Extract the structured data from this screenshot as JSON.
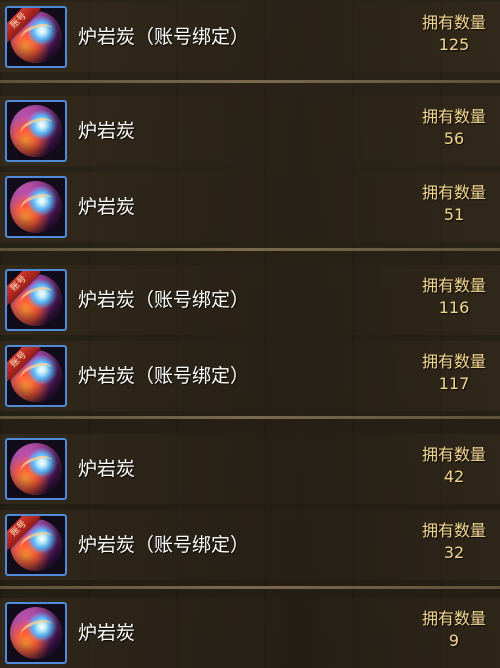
{
  "count_label": "拥有数量",
  "bound_tag": "账号",
  "colors": {
    "name_text": "#ffffff",
    "count_text": "#f3d690",
    "icon_border": "#4f8bd8",
    "bound_ribbon": "#d23b2f"
  },
  "icon": "lava-coal-orb-icon",
  "items": [
    {
      "name": "炉岩炭（账号绑定）",
      "bound": true,
      "count": "125"
    },
    {
      "name": "炉岩炭",
      "bound": false,
      "count": "56"
    },
    {
      "name": "炉岩炭",
      "bound": false,
      "count": "51"
    },
    {
      "name": "炉岩炭（账号绑定）",
      "bound": true,
      "count": "116"
    },
    {
      "name": "炉岩炭（账号绑定）",
      "bound": true,
      "count": "117"
    },
    {
      "name": "炉岩炭",
      "bound": false,
      "count": "42"
    },
    {
      "name": "炉岩炭（账号绑定）",
      "bound": true,
      "count": "32"
    },
    {
      "name": "炉岩炭",
      "bound": false,
      "count": "9"
    }
  ]
}
